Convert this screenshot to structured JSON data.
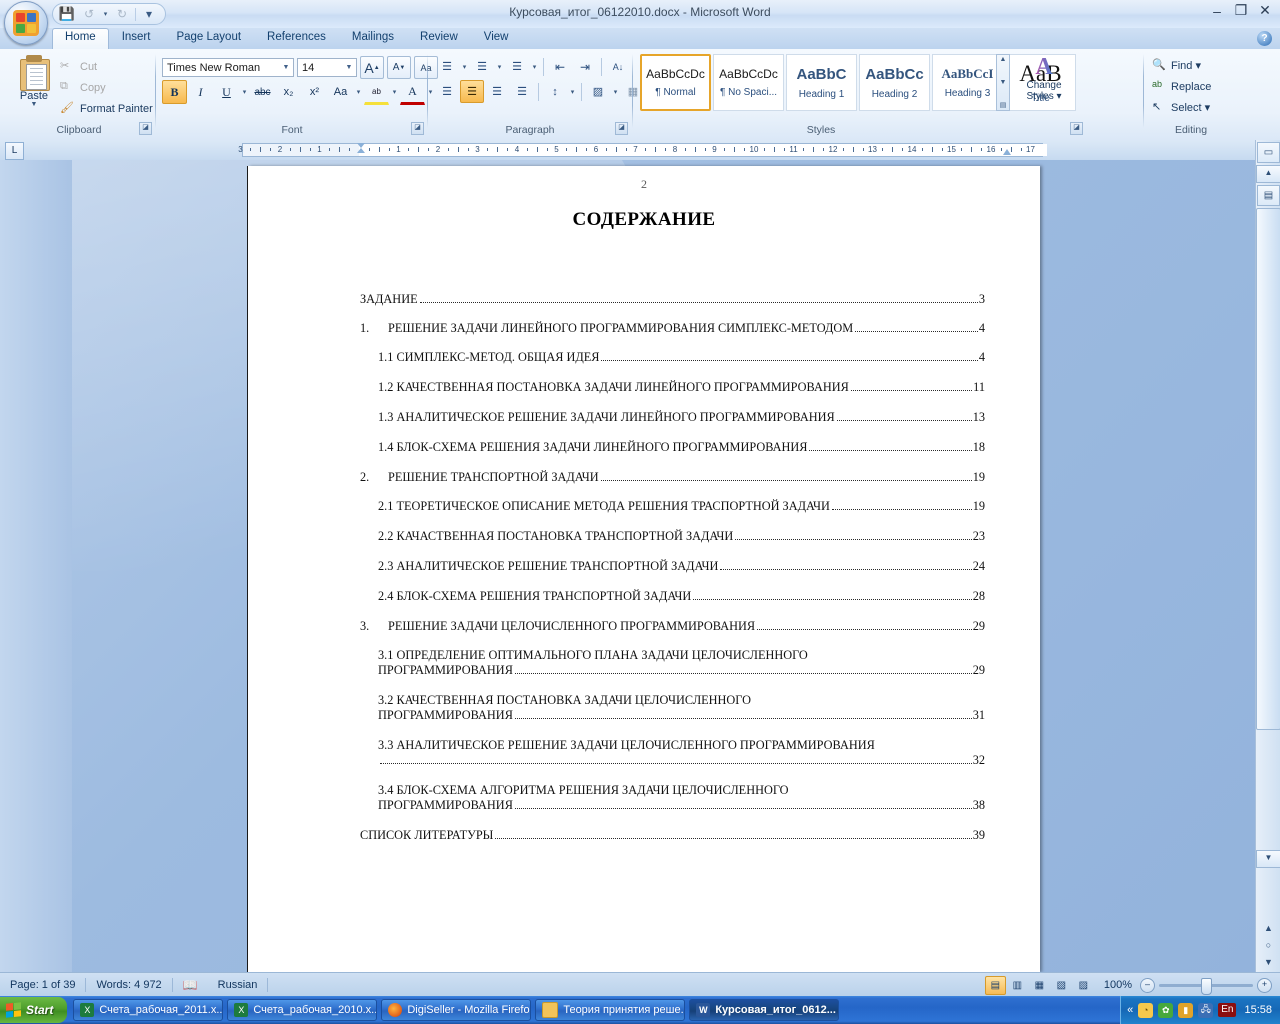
{
  "window": {
    "title": "Курсовая_итог_06122010.docx - Microsoft Word",
    "minimize": "–",
    "maximize": "❐",
    "close": "✕",
    "help": "?"
  },
  "quick_access": {
    "save": "💾",
    "undo": "↺",
    "redo": "↻",
    "customize": "▾"
  },
  "tabs": [
    {
      "label": "Home",
      "active": true
    },
    {
      "label": "Insert",
      "active": false
    },
    {
      "label": "Page Layout",
      "active": false
    },
    {
      "label": "References",
      "active": false
    },
    {
      "label": "Mailings",
      "active": false
    },
    {
      "label": "Review",
      "active": false
    },
    {
      "label": "View",
      "active": false
    }
  ],
  "ribbon": {
    "clipboard": {
      "title": "Clipboard",
      "paste": "Paste",
      "paste_arrow": "▼",
      "cut": "Cut",
      "copy": "Copy",
      "format_painter": "Format Painter",
      "launcher": "◪"
    },
    "font": {
      "title": "Font",
      "font_name": "Times New Roman",
      "font_size": "14",
      "grow_font": "A",
      "shrink_font": "A",
      "clear_formatting": "Aa",
      "bold": "B",
      "italic": "I",
      "underline": "U",
      "strikethrough": "abc",
      "subscript": "x₂",
      "superscript": "x²",
      "change_case": "Aa",
      "highlight": "ab",
      "font_color": "A",
      "launcher": "◪"
    },
    "paragraph": {
      "title": "Paragraph",
      "bullets": "☰",
      "numbering": "☰",
      "multilevel": "☰",
      "decrease_indent": "⇤",
      "increase_indent": "⇥",
      "sort": "A↓",
      "show_marks": "¶",
      "align_left": "☰",
      "align_center": "☰",
      "align_right": "☰",
      "justify": "☰",
      "line_spacing": "↕",
      "shading": "▨",
      "borders": "▦",
      "launcher": "◪"
    },
    "styles": {
      "title": "Styles",
      "items": [
        {
          "preview": "AaBbCcDc",
          "name": "¶ Normal",
          "selected": true
        },
        {
          "preview": "AaBbCcDc",
          "name": "¶ No Spaci...",
          "selected": false
        },
        {
          "preview": "AaBbC",
          "name": "Heading 1",
          "selected": false
        },
        {
          "preview": "AaBbCc",
          "name": "Heading 2",
          "selected": false
        },
        {
          "preview": "AaBbCcI",
          "name": "Heading 3",
          "selected": false
        },
        {
          "preview": "AaB",
          "name": "Title",
          "selected": false
        }
      ],
      "scroll_up": "▲",
      "scroll_down": "▼",
      "scroll_more": "▤",
      "change_styles": "Change",
      "change_styles_2": "Styles ▾",
      "change_styles_icon": "A",
      "launcher": "◪"
    },
    "editing": {
      "title": "Editing",
      "find": "Find  ▾",
      "replace": "Replace",
      "select": "Select  ▾",
      "find_icon": "🔍",
      "replace_icon": "ab",
      "select_icon": "↖"
    }
  },
  "ruler": {
    "tab_selector": "L",
    "left_labels": [
      "3",
      "2",
      "1"
    ],
    "right_labels": [
      "1",
      "2",
      "3",
      "4",
      "5",
      "6",
      "7",
      "8",
      "9",
      "10",
      "11",
      "12",
      "13",
      "14",
      "15",
      "16",
      "17"
    ]
  },
  "document": {
    "page_number": "2",
    "title": "СОДЕРЖАНИЕ",
    "toc": [
      {
        "num": "",
        "text": "ЗАДАНИЕ",
        "page": "3",
        "level": 0,
        "wrap": false
      },
      {
        "num": "1.",
        "text": "РЕШЕНИЕ ЗАДАЧИ ЛИНЕЙНОГО ПРОГРАММИРОВАНИЯ СИМПЛЕКС-МЕТОДОМ",
        "page": "4",
        "level": 0,
        "wrap": false
      },
      {
        "num": "",
        "text": "1.1 СИМПЛЕКС-МЕТОД. ОБЩАЯ ИДЕЯ",
        "page": "4",
        "level": 1,
        "wrap": false
      },
      {
        "num": "",
        "text": "1.2 КАЧЕСТВЕННАЯ ПОСТАНОВКА ЗАДАЧИ ЛИНЕЙНОГО ПРОГРАММИРОВАНИЯ",
        "page": "11",
        "level": 1,
        "wrap": false
      },
      {
        "num": "",
        "text": "1.3 АНАЛИТИЧЕСКОЕ РЕШЕНИЕ ЗАДАЧИ ЛИНЕЙНОГО ПРОГРАММИРОВАНИЯ",
        "page": "13",
        "level": 1,
        "wrap": false
      },
      {
        "num": "",
        "text": "1.4 БЛОК-СХЕМА РЕШЕНИЯ ЗАДАЧИ ЛИНЕЙНОГО ПРОГРАММИРОВАНИЯ",
        "page": "18",
        "level": 1,
        "wrap": false
      },
      {
        "num": "2.",
        "text": "РЕШЕНИЕ ТРАНСПОРТНОЙ ЗАДАЧИ",
        "page": "19",
        "level": 0,
        "wrap": false
      },
      {
        "num": "",
        "text": "2.1 ТЕОРЕТИЧЕСКОЕ ОПИСАНИЕ МЕТОДА РЕШЕНИЯ ТРАСПОРТНОЙ ЗАДАЧИ",
        "page": "19",
        "level": 1,
        "wrap": false
      },
      {
        "num": "",
        "text": "2.2 КАЧАСТВЕННАЯ ПОСТАНОВКА ТРАНСПОРТНОЙ ЗАДАЧИ",
        "page": "23",
        "level": 1,
        "wrap": false
      },
      {
        "num": "",
        "text": "2.3 АНАЛИТИЧЕСКОЕ РЕШЕНИЕ ТРАНСПОРТНОЙ ЗАДАЧИ",
        "page": "24",
        "level": 1,
        "wrap": false
      },
      {
        "num": "",
        "text": "2.4 БЛОК-СХЕМА РЕШЕНИЯ ТРАНСПОРТНОЙ ЗАДАЧИ",
        "page": "28",
        "level": 1,
        "wrap": false
      },
      {
        "num": "3.",
        "text": "РЕШЕНИЕ ЗАДАЧИ ЦЕЛОЧИСЛЕННОГО ПРОГРАММИРОВАНИЯ",
        "page": "29",
        "level": 0,
        "wrap": false
      },
      {
        "num": "",
        "text": "3.1 ОПРЕДЕЛЕНИЕ ОПТИМАЛЬНОГО ПЛАНА ЗАДАЧИ ЦЕЛОЧИСЛЕННОГО",
        "text2": "ПРОГРАММИРОВАНИЯ",
        "page": "29",
        "level": 1,
        "wrap": true
      },
      {
        "num": "",
        "text": "3.2 КАЧЕСТВЕННАЯ ПОСТАНОВКА ЗАДАЧИ ЦЕЛОЧИСЛЕННОГО",
        "text2": "ПРОГРАММИРОВАНИЯ",
        "page": "31",
        "level": 1,
        "wrap": true
      },
      {
        "num": "",
        "text": "3.3 АНАЛИТИЧЕСКОЕ РЕШЕНИЕ ЗАДАЧИ ЦЕЛОЧИСЛЕННОГО ПРОГРАММИРОВАНИЯ",
        "text2": "",
        "page": "32",
        "level": 1,
        "wrap": true
      },
      {
        "num": "",
        "text": "3.4 БЛОК-СХЕМА АЛГОРИТМА РЕШЕНИЯ ЗАДАЧИ ЦЕЛОЧИСЛЕННОГО",
        "text2": "ПРОГРАММИРОВАНИЯ",
        "page": "38",
        "level": 1,
        "wrap": true
      },
      {
        "num": "",
        "text": "СПИСОК ЛИТЕРАТУРЫ",
        "page": "39",
        "level": 0,
        "wrap": false
      }
    ]
  },
  "scrollbar": {
    "up": "▲",
    "down": "▼",
    "page_up": "▲",
    "select_object": "○",
    "page_down": "▼",
    "split": "▭",
    "browse": "▤"
  },
  "status": {
    "page": "Page: 1 of 39",
    "words": "Words: 4 972",
    "language": "Russian",
    "proof_icon": "📖",
    "zoom": "100%",
    "zoom_out": "–",
    "zoom_in": "+",
    "views": [
      {
        "icon": "▤",
        "name": "print-layout",
        "active": true
      },
      {
        "icon": "▥",
        "name": "full-screen-reading",
        "active": false
      },
      {
        "icon": "▦",
        "name": "web-layout",
        "active": false
      },
      {
        "icon": "▧",
        "name": "outline",
        "active": false
      },
      {
        "icon": "▨",
        "name": "draft",
        "active": false
      }
    ]
  },
  "taskbar": {
    "start": "Start",
    "buttons": [
      {
        "label": "Счета_рабочая_2011.x...",
        "icon": "X",
        "kind": "xls",
        "active": false
      },
      {
        "label": "Счета_рабочая_2010.x...",
        "icon": "X",
        "kind": "xls",
        "active": false
      },
      {
        "label": "DigiSeller - Mozilla Firefox",
        "icon": "",
        "kind": "ff",
        "active": false
      },
      {
        "label": "Теория принятия реше...",
        "icon": "",
        "kind": "folder",
        "active": false
      },
      {
        "label": "Курсовая_итог_0612...",
        "icon": "W",
        "kind": "word",
        "active": true
      }
    ],
    "tray": {
      "expand": "«",
      "icons": [
        "◔",
        "✿",
        "▮",
        "🖧"
      ],
      "language": "En",
      "clock": "15:58"
    }
  }
}
